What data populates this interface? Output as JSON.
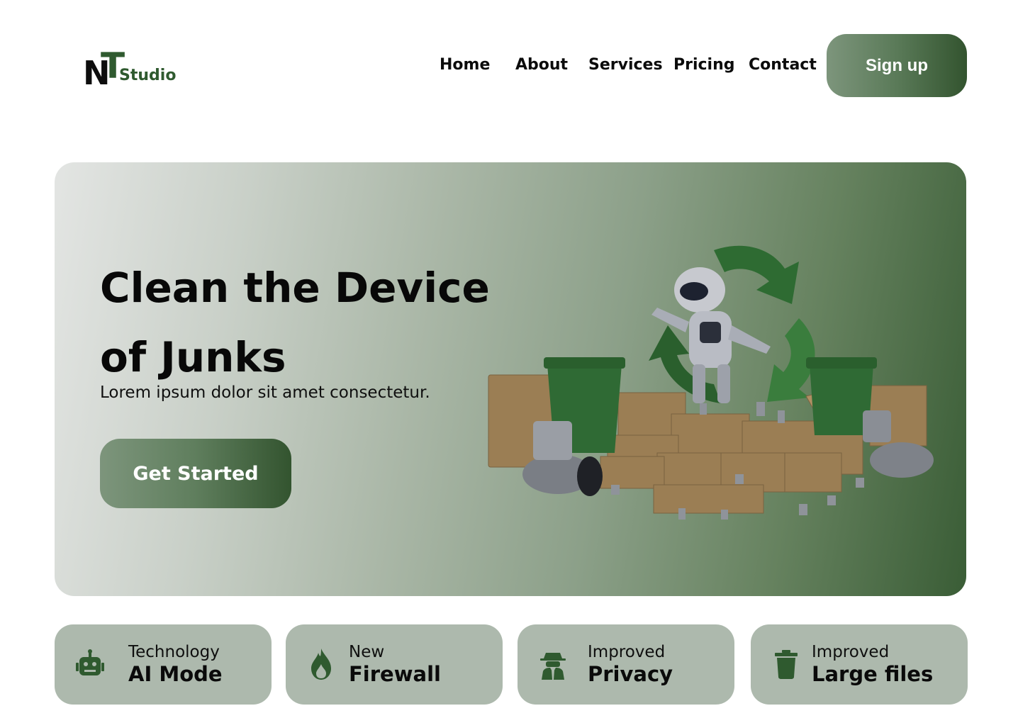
{
  "logo": {
    "n": "N",
    "t": "T",
    "studio": "Studio"
  },
  "nav": {
    "home": "Home",
    "about": "About",
    "services": "Services",
    "pricing": "Pricing",
    "contact": "Contact"
  },
  "header": {
    "signup_label": "Sign up"
  },
  "hero": {
    "title": "Clean the Device of Junks",
    "subtitle": "Lorem ipsum dolor sit amet consectetur.",
    "cta_label": "Get Started"
  },
  "features": [
    {
      "icon": "robot-icon",
      "small": "Technology",
      "big": "AI Mode"
    },
    {
      "icon": "flame-icon",
      "small": "New",
      "big": "Firewall"
    },
    {
      "icon": "spy-icon",
      "small": "Improved",
      "big": "Privacy"
    },
    {
      "icon": "trash-icon",
      "small": "Improved",
      "big": "Large files"
    }
  ],
  "colors": {
    "brand_green": "#2f5a2f",
    "card_bg": "#adb9ad",
    "button_gradient_start": "#7d957c",
    "button_gradient_end": "#33542f"
  }
}
